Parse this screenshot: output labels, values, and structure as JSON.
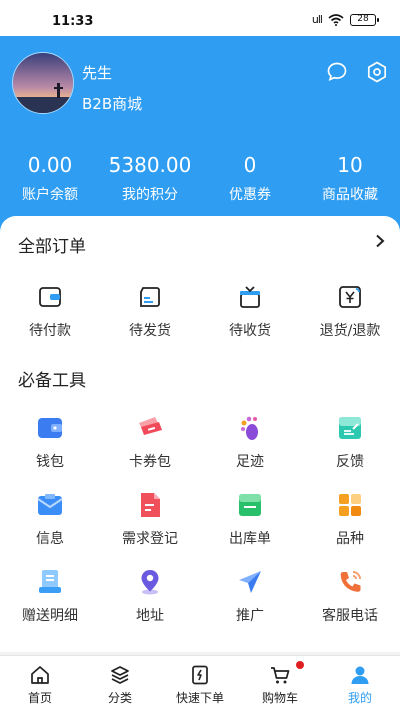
{
  "status_bar": {
    "time": "11:33",
    "network": "ull",
    "battery": "28"
  },
  "header": {
    "name": "先生",
    "shop": "B2B商城",
    "stats": [
      {
        "value": "0.00",
        "label": "账户余额"
      },
      {
        "value": "5380.00",
        "label": "我的积分"
      },
      {
        "value": "0",
        "label": "优惠券"
      },
      {
        "value": "10",
        "label": "商品收藏"
      }
    ]
  },
  "orders": {
    "title": "全部订单",
    "items": [
      {
        "label": "待付款",
        "icon": "wallet-icon"
      },
      {
        "label": "待发货",
        "icon": "box-icon"
      },
      {
        "label": "待收货",
        "icon": "gift-icon"
      },
      {
        "label": "退货/退款",
        "icon": "refund-icon"
      }
    ]
  },
  "tools": {
    "title": "必备工具",
    "items": [
      {
        "label": "钱包",
        "icon": "wallet-icon",
        "color": "#3b7cf0"
      },
      {
        "label": "卡券包",
        "icon": "ticket-icon",
        "color": "#f04a5a"
      },
      {
        "label": "足迹",
        "icon": "footprint-icon",
        "color": "#8a4bd8"
      },
      {
        "label": "反馈",
        "icon": "feedback-icon",
        "color": "#2cc8b0"
      },
      {
        "label": "信息",
        "icon": "message-icon",
        "color": "#3b8ef5"
      },
      {
        "label": "需求登记",
        "icon": "document-icon",
        "color": "#f0505a"
      },
      {
        "label": "出库单",
        "icon": "outbound-icon",
        "color": "#28c06a"
      },
      {
        "label": "品种",
        "icon": "category-icon",
        "color": "#f5a020"
      },
      {
        "label": "赠送明细",
        "icon": "list-icon",
        "color": "#3b9ef5"
      },
      {
        "label": "地址",
        "icon": "location-icon",
        "color": "#6a5ae0"
      },
      {
        "label": "推广",
        "icon": "share-icon",
        "color": "#3b7cf0"
      },
      {
        "label": "客服电话",
        "icon": "phone-icon",
        "color": "#f0703a"
      }
    ]
  },
  "tabbar": {
    "items": [
      {
        "label": "首页",
        "icon": "home-icon"
      },
      {
        "label": "分类",
        "icon": "layers-icon"
      },
      {
        "label": "快速下单",
        "icon": "quick-order-icon"
      },
      {
        "label": "购物车",
        "icon": "cart-icon"
      },
      {
        "label": "我的",
        "icon": "profile-icon"
      }
    ],
    "active_index": 4
  },
  "colors": {
    "primary": "#2e9df2",
    "badge": "#e02020"
  }
}
